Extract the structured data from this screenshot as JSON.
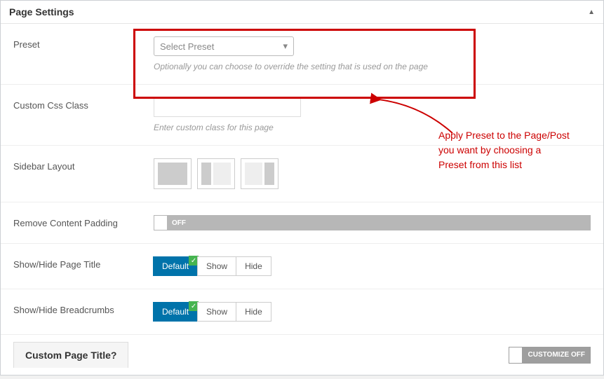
{
  "panel": {
    "title": "Page Settings"
  },
  "preset": {
    "label": "Preset",
    "placeholder": "Select Preset",
    "hint": "Optionally you can choose to override the setting that is used on the page"
  },
  "css_class": {
    "label": "Custom Css Class",
    "hint": "Enter custom class for this page"
  },
  "sidebar_layout": {
    "label": "Sidebar Layout"
  },
  "remove_padding": {
    "label": "Remove Content Padding",
    "state": "OFF"
  },
  "page_title": {
    "label": "Show/Hide Page Title",
    "options": [
      "Default",
      "Show",
      "Hide"
    ],
    "active": "Default"
  },
  "breadcrumbs": {
    "label": "Show/Hide Breadcrumbs",
    "options": [
      "Default",
      "Show",
      "Hide"
    ],
    "active": "Default"
  },
  "footer": {
    "title": "Custom Page Title?",
    "toggle": "CUSTOMIZE OFF"
  },
  "annotation": {
    "line1": "Apply Preset to the Page/Post",
    "line2": "you want by choosing a",
    "line3": "Preset from this list"
  }
}
